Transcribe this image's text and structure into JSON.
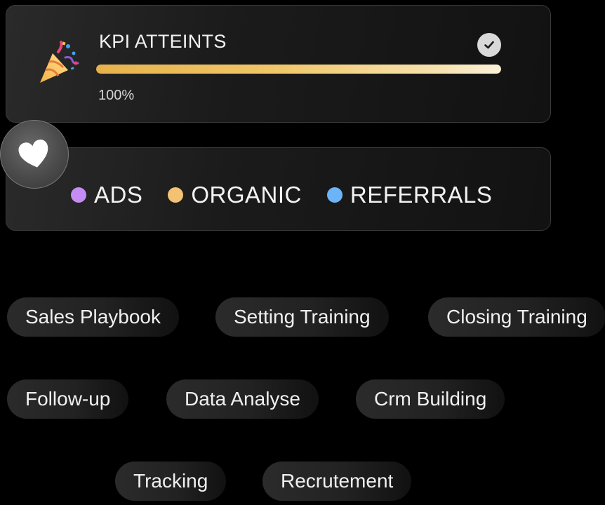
{
  "kpi": {
    "title": "KPI ATTEINTS",
    "value_text": "100%",
    "progress": 1.0,
    "party_icon": "party-popper-icon",
    "check_icon": "check-circle-icon"
  },
  "badge": {
    "icon": "heart-icon"
  },
  "sources": [
    {
      "label": "ADS",
      "color": "#c58cf4"
    },
    {
      "label": "ORGANIC",
      "color": "#f3c272"
    },
    {
      "label": "REFERRALS",
      "color": "#6cb4f7"
    }
  ],
  "skills": [
    "Sales Playbook",
    "Setting Training",
    "Closing Training",
    "Follow-up",
    "Data Analyse",
    "Crm Building",
    "Tracking",
    "Recrutement"
  ]
}
